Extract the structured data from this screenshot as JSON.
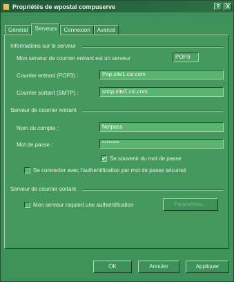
{
  "window": {
    "title": "Propriétés de wpostal compuserve",
    "help_button": "?",
    "close_button": "X"
  },
  "tabs": [
    "Général",
    "Serveurs",
    "Connexion",
    "Avancé"
  ],
  "active_tab": "Serveurs",
  "server_info": {
    "group_label": "Informations sur le serveur",
    "incoming_type_label": "Mon serveur de courrier entrant est un serveur",
    "incoming_type_value": "POP3",
    "incoming_label": "Courrier entrant (POP3) :",
    "incoming_value": "Pop.site1.csi.com",
    "outgoing_label": "Courrier sortant (SMTP) :",
    "outgoing_value": "smtp.site1.csi.com"
  },
  "incoming_server": {
    "group_label": "Serveur de courrier entrant",
    "account_label": "Nom du compte :",
    "account_value": "Netpass",
    "password_label": "Mot de passe :",
    "password_value": "********",
    "remember_label": "Se souvenir du mot de passe",
    "remember_checked": true,
    "spa_label": "Se connecter avec l'authentification par mot de passe sécurisé",
    "spa_checked": false
  },
  "outgoing_server": {
    "group_label": "Serveur de courrier sortant",
    "auth_label": "Mon serveur requiert une authentification",
    "auth_checked": false,
    "settings_button": "Paramètres..."
  },
  "buttons": {
    "ok": "OK",
    "cancel": "Annuler",
    "apply": "Appliquer"
  },
  "colors": {
    "window": "#3f915a",
    "titlebar": "#1f5a36",
    "field": "#59b46f"
  }
}
